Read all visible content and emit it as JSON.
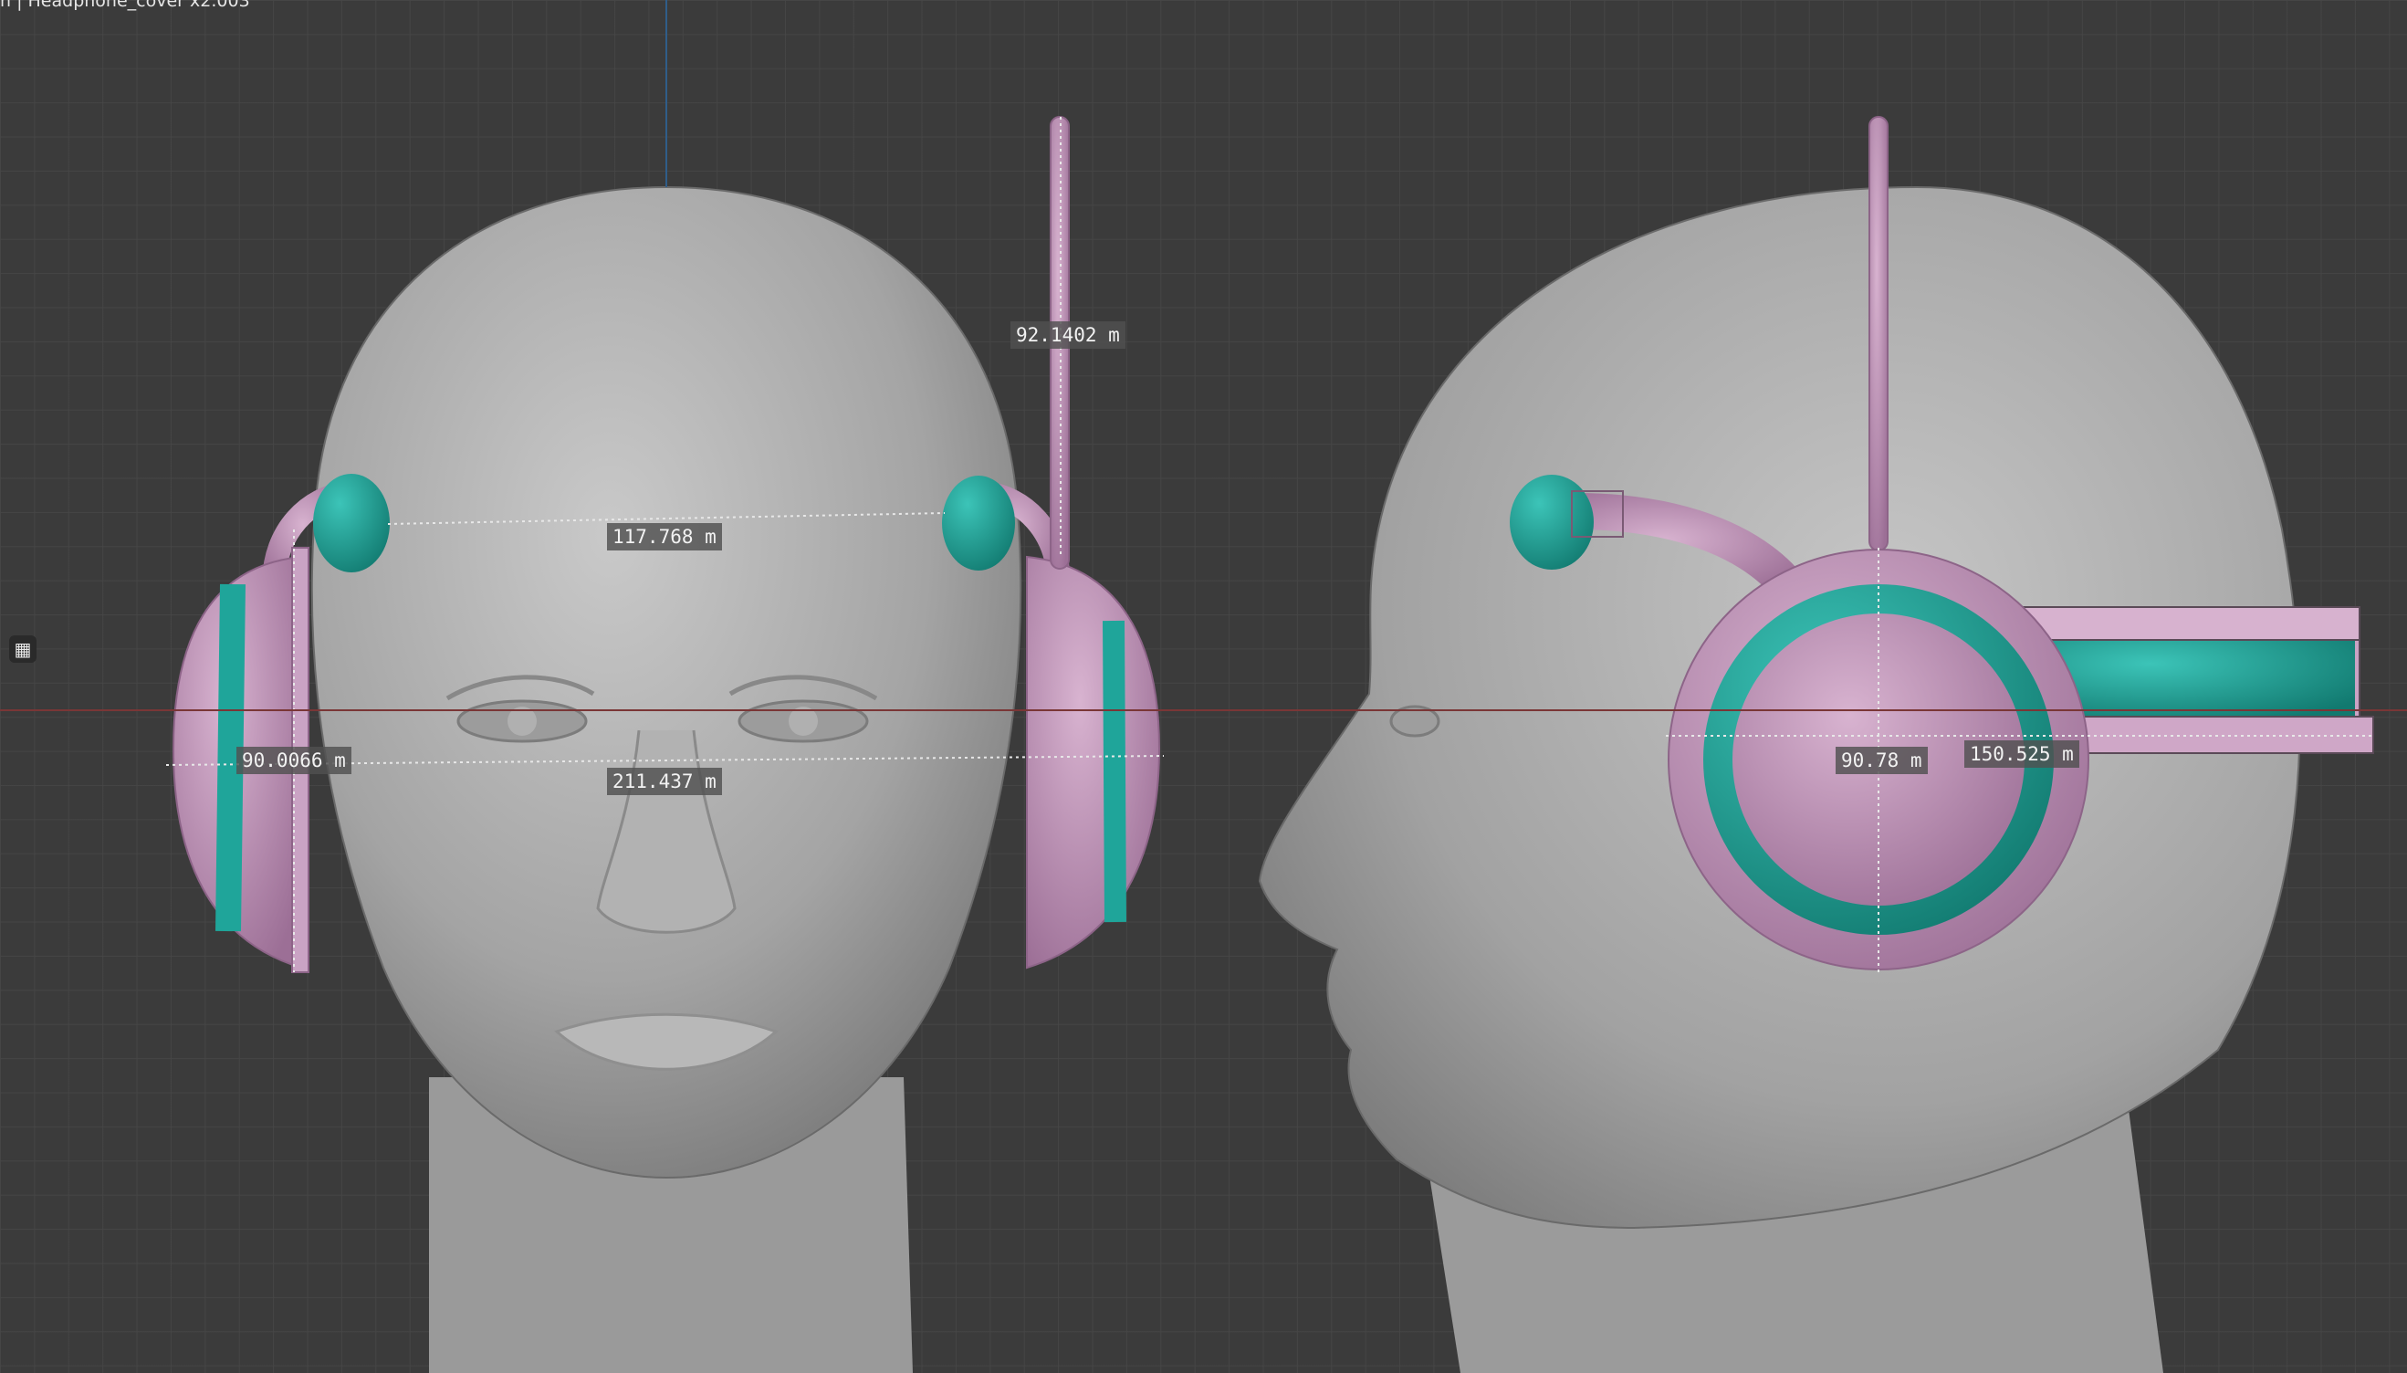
{
  "window": {
    "title": "n | Headphone_cover x2.003"
  },
  "measurements": {
    "front_top_width": "117.768 m",
    "antenna_height": "92.1402 m",
    "cup_depth_front": "90.0066 m",
    "cup_span": "211.437 m",
    "cup_diameter_side": "90.78 m",
    "band_length": "150.525 m"
  },
  "toolbar": {
    "tool_icon": "grid-tool-icon"
  },
  "colors": {
    "background": "#3b3b3b",
    "grid_line": "#464646",
    "skin": "#a8a8a8",
    "headphone_pink": "#c79ac0",
    "headphone_teal": "#1fa59a",
    "axis_x": "#7a3636",
    "axis_y": "#2f5d8a"
  }
}
